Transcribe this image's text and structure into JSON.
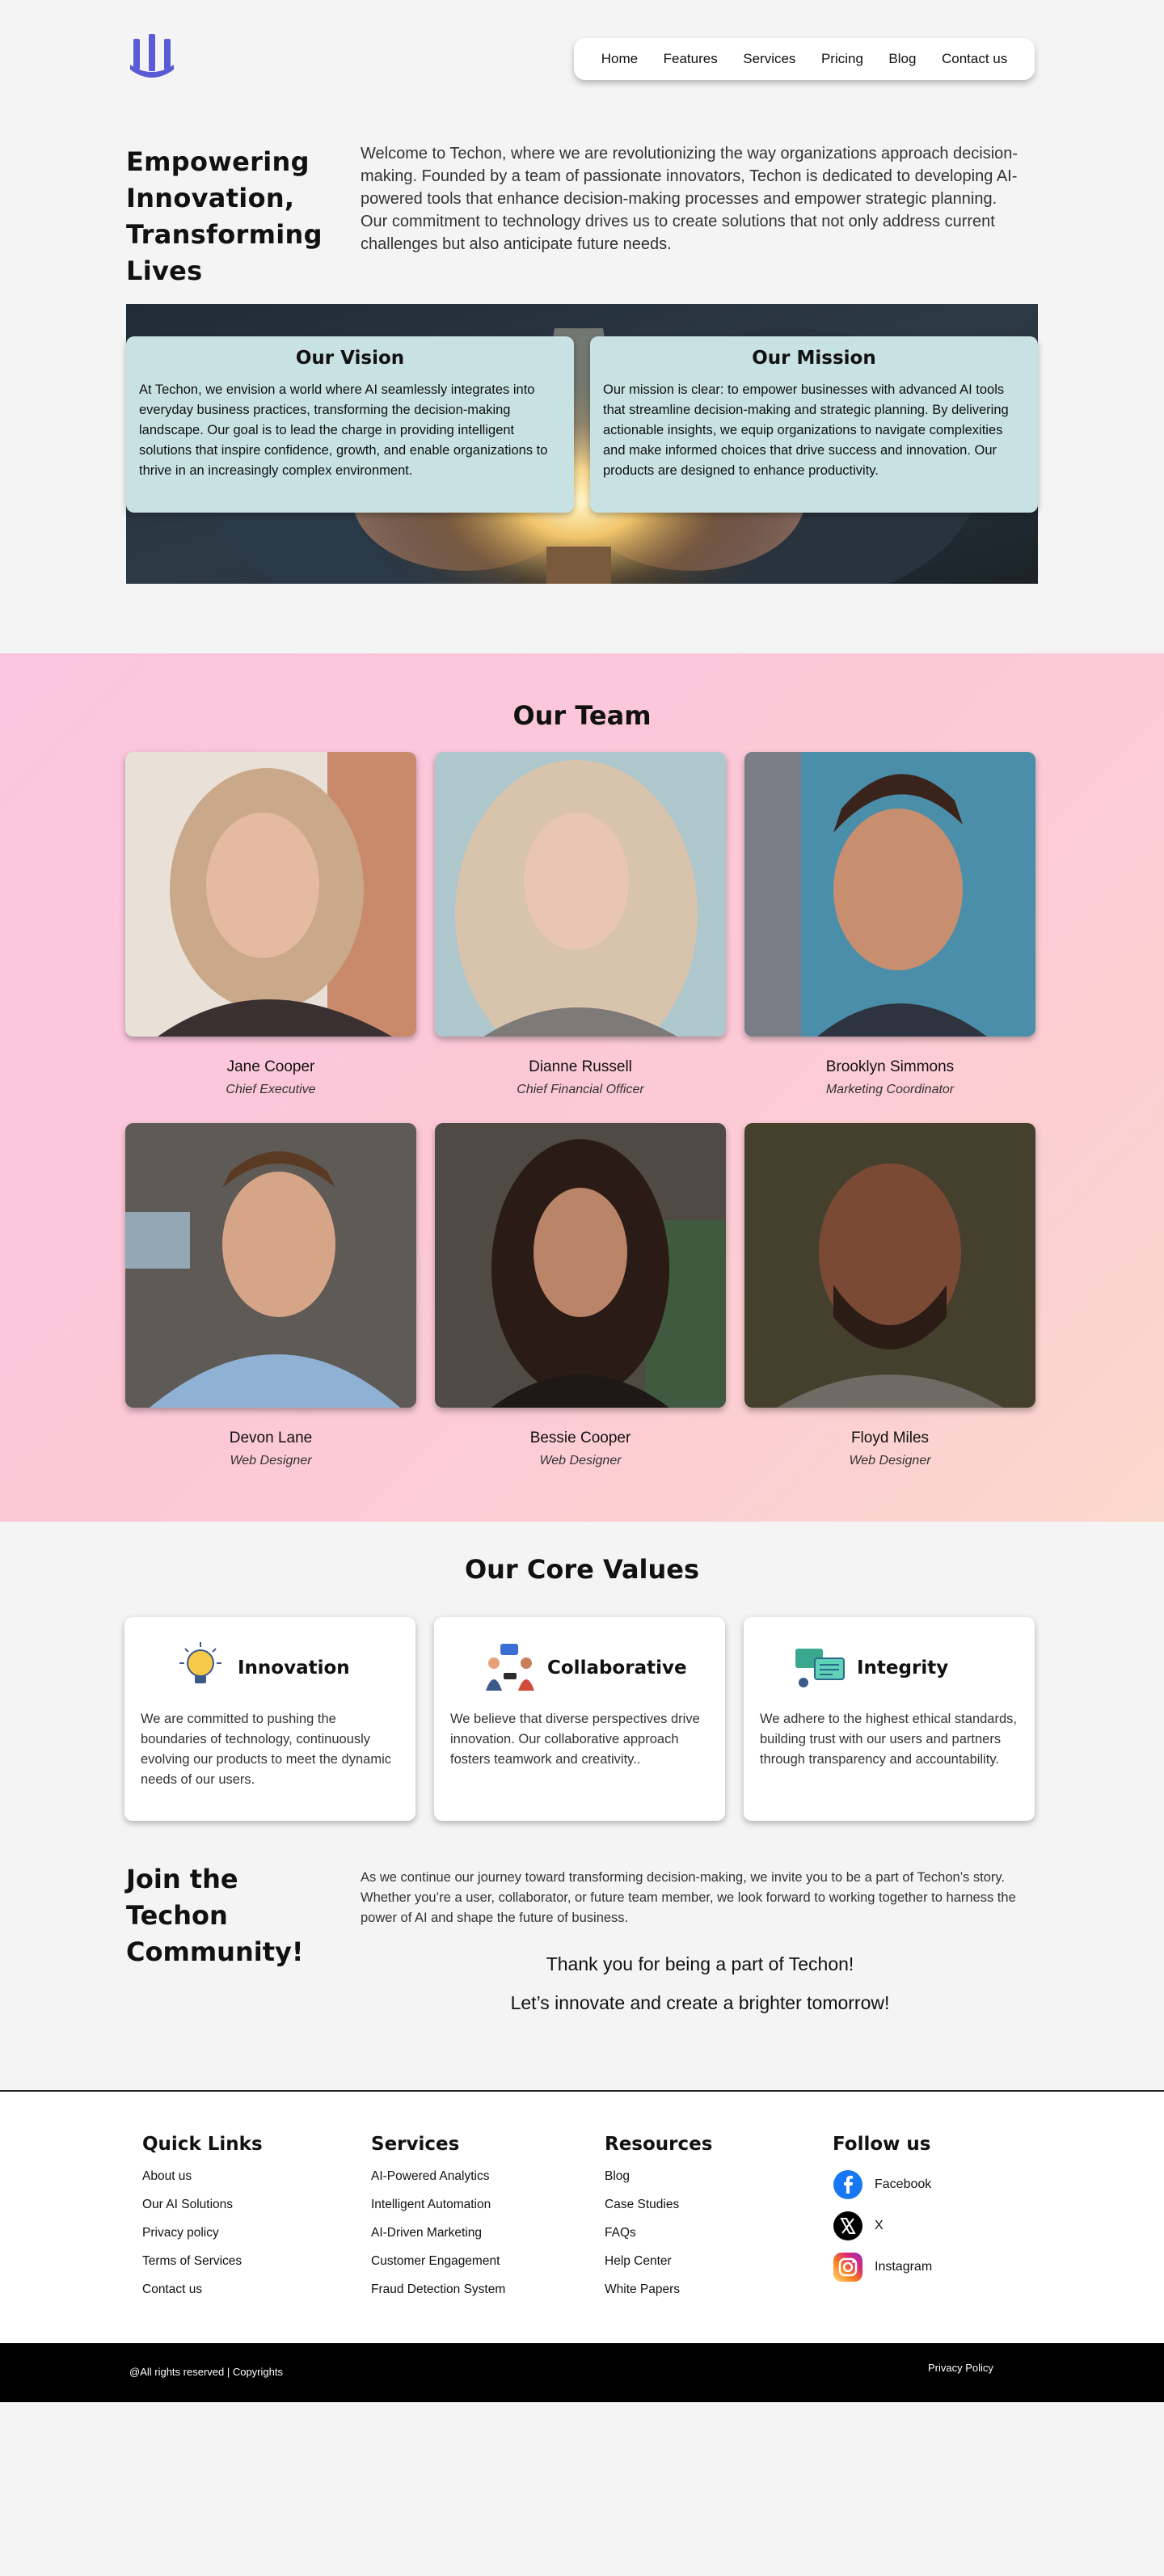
{
  "nav": {
    "items": [
      "Home",
      "Features",
      "Services",
      "Pricing",
      "Blog",
      "Contact us"
    ]
  },
  "intro": {
    "title": "Empowering Innovation, Transforming Lives",
    "text": "Welcome to Techon, where we are revolutionizing the way organizations approach decision-making. Founded by a team of passionate innovators, Techon is dedicated to developing AI-powered tools that enhance decision-making processes and empower strategic planning. Our commitment to technology drives us to create solutions that not only address current challenges but also anticipate future needs."
  },
  "vision": {
    "title": "Our Vision",
    "text": "At Techon, we envision a world where AI seamlessly integrates into everyday business practices, transforming the decision-making landscape. Our goal is to lead the charge in providing intelligent solutions that inspire confidence, growth, and enable organizations to thrive in an increasingly complex environment."
  },
  "mission": {
    "title": "Our Mission",
    "text": "Our mission is clear: to empower businesses with advanced AI tools that streamline decision-making and strategic planning. By delivering actionable insights, we equip organizations to navigate complexities and make informed choices that drive success and innovation. Our products are designed to enhance productivity."
  },
  "team": {
    "title": "Our Team",
    "members": [
      {
        "name": "Jane Cooper",
        "role": "Chief Executive"
      },
      {
        "name": "Dianne Russell",
        "role": "Chief Financial Officer"
      },
      {
        "name": "Brooklyn Simmons",
        "role": "Marketing Coordinator"
      },
      {
        "name": "Devon Lane",
        "role": "Web Designer"
      },
      {
        "name": "Bessie Cooper",
        "role": "Web Designer"
      },
      {
        "name": "Floyd Miles",
        "role": "Web Designer"
      }
    ]
  },
  "values": {
    "title": "Our Core Values",
    "cards": [
      {
        "title": "Innovation",
        "icon": "lightbulb-icon",
        "text": "We are committed to pushing the boundaries of technology, continuously evolving our products to meet the dynamic needs of our users."
      },
      {
        "title": "Collaborative",
        "icon": "collaboration-icon",
        "text": "We believe that diverse perspectives drive innovation. Our collaborative approach fosters teamwork and creativity.."
      },
      {
        "title": "Integrity",
        "icon": "integrity-icon",
        "text": "We adhere to the highest ethical standards, building trust with our users and partners through transparency and accountability."
      }
    ]
  },
  "join": {
    "title": "Join the Techon Community!",
    "text": "As we continue our journey toward transforming decision-making, we invite you to be a part of Techon’s story. Whether you’re a user, collaborator, or future team member, we look forward to working together to harness the power of AI and shape the future of business.",
    "thanks1": "Thank you for being a part of Techon!",
    "thanks2": "Let’s innovate and create a brighter tomorrow!"
  },
  "footer": {
    "quick_links": {
      "title": "Quick Links",
      "items": [
        "About us",
        "Our AI Solutions",
        "Privacy policy",
        "Terms of Services",
        "Contact us"
      ]
    },
    "services": {
      "title": "Services",
      "items": [
        "AI-Powered Analytics",
        "Intelligent Automation",
        "AI-Driven Marketing",
        "Customer Engagement",
        "Fraud Detection System"
      ]
    },
    "resources": {
      "title": "Resources",
      "items": [
        "Blog",
        "Case Studies",
        "FAQs",
        "Help Center",
        "White Papers"
      ]
    },
    "follow": {
      "title": "Follow us",
      "items": [
        {
          "label": "Facebook",
          "icon": "facebook-icon",
          "color": "#1877f2"
        },
        {
          "label": "X",
          "icon": "x-icon",
          "color": "#000000"
        },
        {
          "label": "Instagram",
          "icon": "instagram-icon",
          "color": "#e1306c"
        }
      ]
    }
  },
  "bottom": {
    "copyright": "@All rights reserved | Copyrights",
    "privacy": "Privacy Policy"
  },
  "colors": {
    "accent": "#5b5bd6",
    "card_teal": "#c8e1e2",
    "team_bg": "#fbc8da"
  }
}
